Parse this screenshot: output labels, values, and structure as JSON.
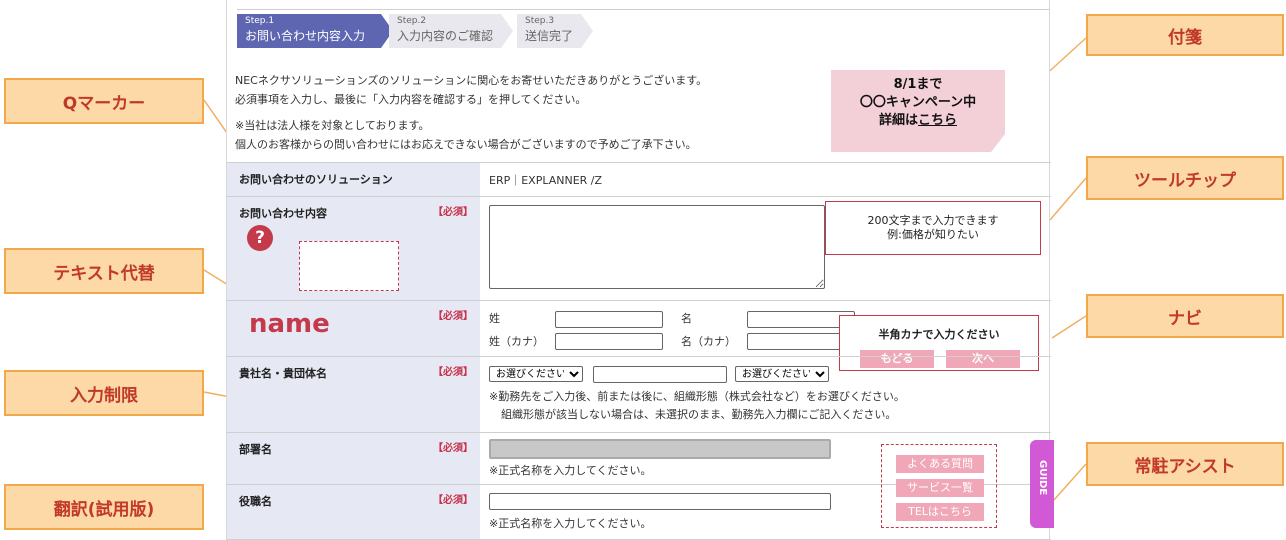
{
  "steps": [
    {
      "num": "Step.1",
      "title": "お問い合わせ内容入力",
      "active": true
    },
    {
      "num": "Step.2",
      "title": "入力内容のご確認",
      "active": false
    },
    {
      "num": "Step.3",
      "title": "送信完了",
      "active": false
    }
  ],
  "intro": {
    "line1": "NECネクサソリューションズのソリューションに関心をお寄せいただきありがとうございます。",
    "line2": "必須事項を入力し、最後に「入力内容を確認する」を押してください。",
    "line3": "※当社は法人様を対象としております。",
    "line4": "個人のお客様からの問い合わせにはお応えできない場合がございますので予めご了承下さい。"
  },
  "sticky": {
    "line1": "8/1まで",
    "line2": "〇〇キャンペーン中",
    "line3_prefix": "詳細は",
    "line3_link": "こちら"
  },
  "form": {
    "required": "【必須】",
    "solution_label": "お問い合わせのソリューション",
    "solution_value": "ERP｜EXPLANNER /Z",
    "inquiry_label": "お問い合わせ内容",
    "qmark": "?",
    "name_label": "name",
    "sei": "姓",
    "mei": "名",
    "sei_kana": "姓（カナ）",
    "mei_kana": "名（カナ）",
    "company_label": "貴社名・貴団体名",
    "company_select1": "お選びください",
    "company_select2": "お選びください",
    "company_note1": "※勤務先をご入力後、前または後に、組織形態（株式会社など）をお選びください。",
    "company_note2": "組織形態が該当しない場合は、未選択のまま、勤務先入力欄にご記入ください。",
    "dept_label": "部署名",
    "dept_note": "※正式名称を入力してください。",
    "title_label": "役職名",
    "title_note": "※正式名称を入力してください。"
  },
  "tooltip": {
    "line1": "200文字まで入力できます",
    "line2": "例:価格が知りたい"
  },
  "navi": {
    "text": "半角カナで入力ください",
    "back": "もどる",
    "next": "次へ"
  },
  "assist": {
    "faq": "よくある質問",
    "services": "サービス一覧",
    "tel": "TELはこちら",
    "guide": "GUIDE"
  },
  "callouts": {
    "qmarker": "Qマーカー",
    "text_alt": "テキスト代替",
    "input_limit": "入力制限",
    "translate": "翻訳(試用版)",
    "sticky": "付箋",
    "tooltip": "ツールチップ",
    "navi": "ナビ",
    "assist": "常駐アシスト"
  },
  "colors": {
    "callout_bg": "#fcd9a6",
    "callout_border": "#f0a848",
    "callout_text": "#c0392b",
    "step_active": "#5e66b1",
    "accent_red": "#c33a4a",
    "pink_button": "#f0a8b8",
    "guide_tab": "#d259d6"
  }
}
